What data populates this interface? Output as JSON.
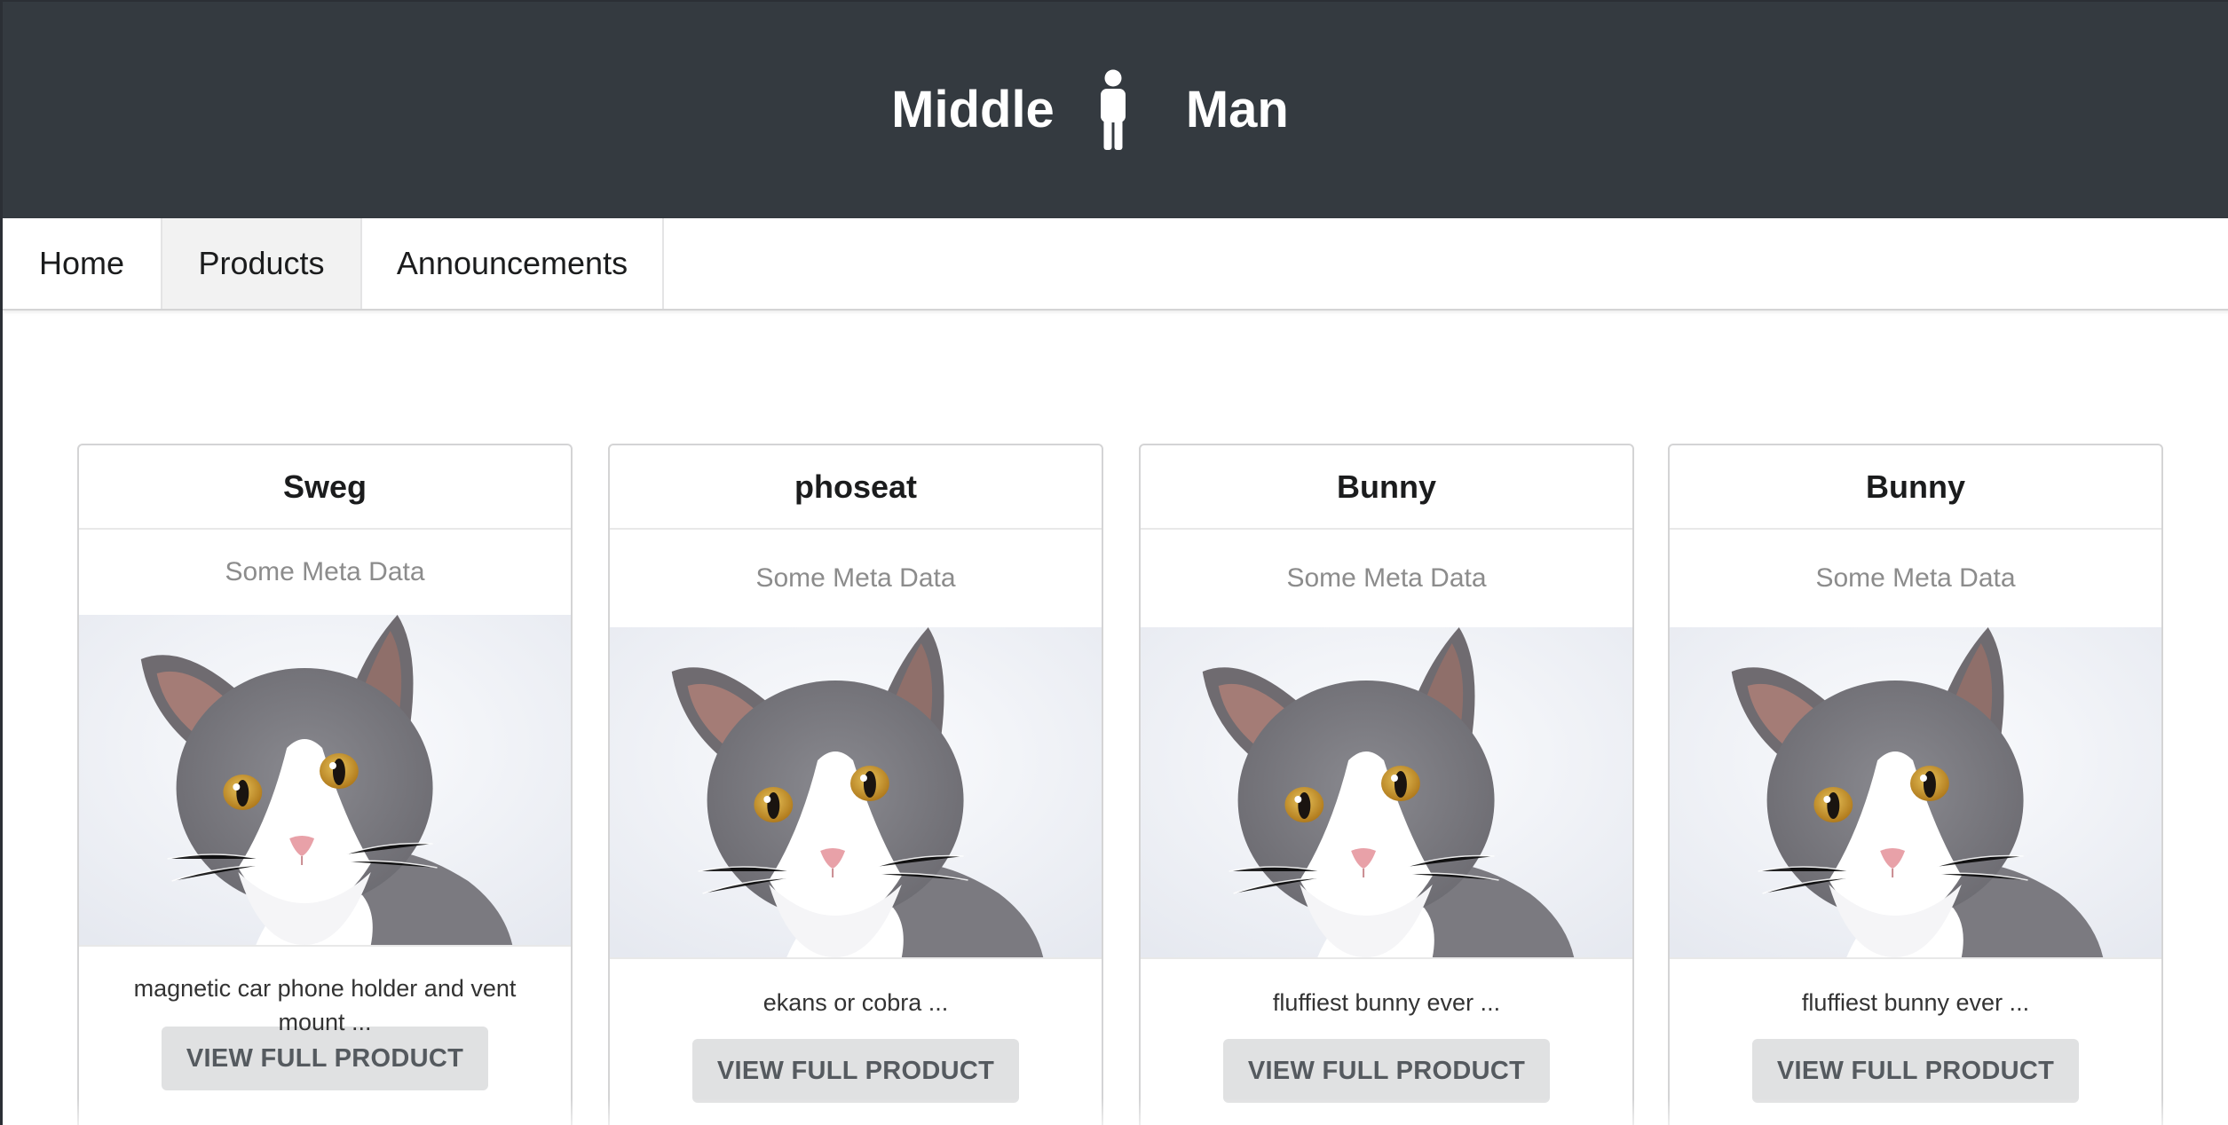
{
  "header": {
    "brand_left": "Middle",
    "brand_icon": "person-icon",
    "brand_right": "Man",
    "background": "#343a40"
  },
  "nav": {
    "items": [
      {
        "label": "Home",
        "active": false
      },
      {
        "label": "Products",
        "active": true
      },
      {
        "label": "Announcements",
        "active": false
      }
    ]
  },
  "products": [
    {
      "title": "Sweg",
      "meta": "Some Meta Data",
      "image": "cat-photo",
      "description": "magnetic car phone holder and vent mount ...",
      "button": "VIEW FULL PRODUCT"
    },
    {
      "title": "phoseat",
      "meta": "Some Meta Data",
      "image": "cat-photo",
      "description": "ekans or cobra ...",
      "button": "VIEW FULL PRODUCT"
    },
    {
      "title": "Bunny",
      "meta": "Some Meta Data",
      "image": "cat-photo",
      "description": "fluffiest bunny ever ...",
      "button": "VIEW FULL PRODUCT"
    },
    {
      "title": "Bunny",
      "meta": "Some Meta Data",
      "image": "cat-photo",
      "description": "fluffiest bunny ever ...",
      "button": "VIEW FULL PRODUCT"
    }
  ]
}
